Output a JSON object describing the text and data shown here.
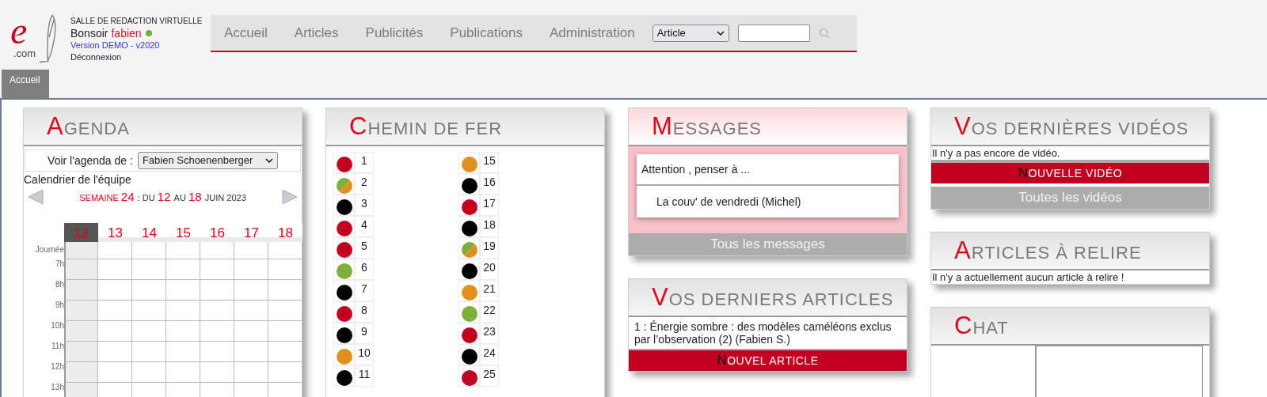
{
  "header": {
    "logo": {
      "letter": "e",
      "suffix": ".com"
    },
    "app_title": "SALLE DE REDACTION VIRTUELLE",
    "greeting": "Bonsoir",
    "user": "fabien",
    "online": true,
    "version": "Version DEMO - v2020",
    "logout": "Déconnexion"
  },
  "nav": {
    "items": [
      "Accueil",
      "Articles",
      "Publicités",
      "Publications",
      "Administration"
    ],
    "search_type": "Article"
  },
  "tabs": [
    {
      "label": "Accueil",
      "selected": true
    }
  ],
  "agenda": {
    "title": "AGENDA",
    "filter_label": "Voir l'agenda de :",
    "filter_value": "Fabien Schoenenberger",
    "calendar_title": "Calendrier de l'équipe",
    "week": "SEMAINE 24 : DU 12 AU 18 JUIN 2023",
    "days": [
      {
        "label": "12",
        "selected": true
      },
      {
        "label": "13",
        "selected": false
      },
      {
        "label": "14",
        "selected": false
      },
      {
        "label": "15",
        "selected": false
      },
      {
        "label": "16",
        "selected": false
      },
      {
        "label": "17",
        "selected": false
      },
      {
        "label": "18",
        "selected": false
      }
    ],
    "rows": [
      "Journée",
      "7h",
      "8h",
      "9h",
      "10h",
      "11h",
      "12h",
      "13h"
    ]
  },
  "railway": {
    "title": "CHEMIN DE FER",
    "columns": [
      [
        {
          "number": "1",
          "color": "#c3001f"
        },
        {
          "number": "2",
          "halves": [
            {
              "color": "#7bb03a"
            },
            {
              "color": "#e0901e"
            }
          ]
        },
        {
          "number": "3",
          "color": "#000000"
        },
        {
          "number": "4",
          "color": "#c3001f"
        },
        {
          "number": "5",
          "color": "#c3001f"
        },
        {
          "number": "6",
          "color": "#7bb03a"
        },
        {
          "number": "7",
          "color": "#000000"
        },
        {
          "number": "8",
          "color": "#c3001f"
        },
        {
          "number": "9",
          "color": "#000000"
        },
        {
          "number": "10",
          "color": "#e0901e"
        },
        {
          "number": "11",
          "color": "#000000"
        }
      ],
      [
        {
          "number": "15",
          "color": "#e0901e"
        },
        {
          "number": "16",
          "color": "#000000"
        },
        {
          "number": "17",
          "color": "#c3001f"
        },
        {
          "number": "18",
          "color": "#000000"
        },
        {
          "number": "19",
          "halves": [
            {
              "color": "#7bb03a"
            },
            {
              "color": "#e0901e"
            }
          ]
        },
        {
          "number": "20",
          "color": "#000000"
        },
        {
          "number": "21",
          "color": "#e0901e"
        },
        {
          "number": "22",
          "color": "#7bb03a"
        },
        {
          "number": "23",
          "color": "#c3001f"
        },
        {
          "number": "24",
          "color": "#000000"
        },
        {
          "number": "25",
          "color": "#c3001f"
        }
      ]
    ]
  },
  "messages": {
    "title": "MESSAGES",
    "items": [
      {
        "text": "Attention , penser à ...",
        "kind": "heading"
      },
      {
        "text": "La couv' de vendredi (Michel)",
        "kind": "entry"
      }
    ],
    "link": "Tous les messages"
  },
  "latest_articles": {
    "title": "VOS DERNIERS ARTICLES",
    "items": [
      "1 : Énergie sombre : des modèles caméléons exclus par l’observation (2) (Fabien S.)"
    ],
    "button": "NOUVEL ARTICLE"
  },
  "videos": {
    "title": "VOS DERNIÈRES VIDÉOS",
    "empty_text": "Il n'y a pas encore de vidéo.",
    "button": "NOUVELLE VIDÉO",
    "link": "Toutes les vidéos"
  },
  "review": {
    "title": "ARTICLES À RELIRE",
    "empty_text": "Il n'y a actuellement aucun article à relire !"
  },
  "chat": {
    "title": "CHAT"
  }
}
